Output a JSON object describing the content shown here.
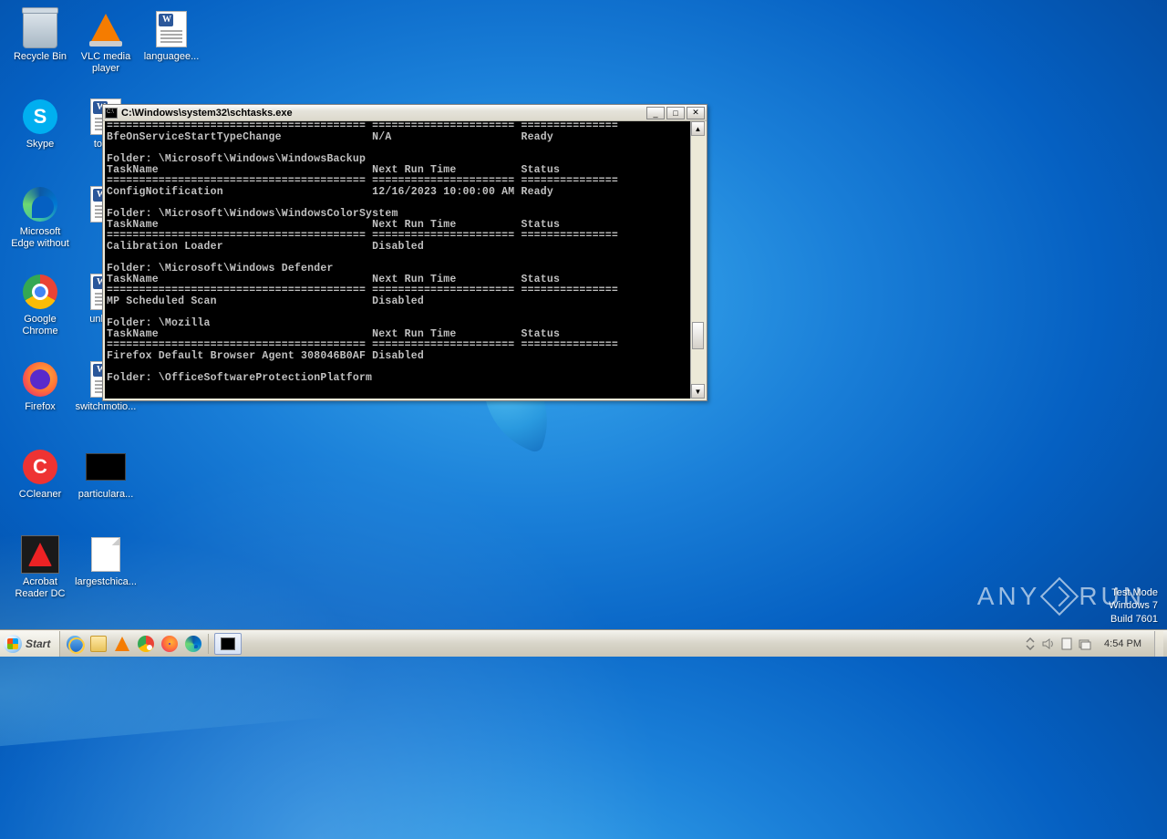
{
  "desktop": {
    "icons_col1": [
      {
        "label": "Recycle Bin",
        "art": "bin"
      },
      {
        "label": "Skype",
        "art": "skype"
      },
      {
        "label": "Microsoft Edge without",
        "art": "edge"
      },
      {
        "label": "Google Chrome",
        "art": "chrome"
      },
      {
        "label": "Firefox",
        "art": "firefox"
      },
      {
        "label": "CCleaner",
        "art": "ccleaner"
      },
      {
        "label": "Acrobat Reader DC",
        "art": "acrobat"
      }
    ],
    "icons_col2": [
      {
        "label": "VLC media player",
        "art": "vlc"
      },
      {
        "label": "toysd",
        "art": "docx"
      },
      {
        "label": "",
        "art": "docx"
      },
      {
        "label": "unknov",
        "art": "docx"
      },
      {
        "label": "switchmotio...",
        "art": "docx"
      },
      {
        "label": "particulara...",
        "art": "blackfile"
      },
      {
        "label": "largestchica...",
        "art": "genericfile"
      }
    ],
    "icons_col3": [
      {
        "label": "languagee...",
        "art": "docx"
      }
    ]
  },
  "console": {
    "title": "C:\\Windows\\system32\\schtasks.exe",
    "sep": "======================================== ====================== ===============",
    "rows": [
      "BfeOnServiceStartTypeChange              N/A                    Ready",
      "",
      "Folder: \\Microsoft\\Windows\\WindowsBackup",
      "TaskName                                 Next Run Time          Status",
      "======================================== ====================== ===============",
      "ConfigNotification                       12/16/2023 10:00:00 AM Ready",
      "",
      "Folder: \\Microsoft\\Windows\\WindowsColorSystem",
      "TaskName                                 Next Run Time          Status",
      "======================================== ====================== ===============",
      "Calibration Loader                       Disabled",
      "",
      "Folder: \\Microsoft\\Windows Defender",
      "TaskName                                 Next Run Time          Status",
      "======================================== ====================== ===============",
      "MP Scheduled Scan                        Disabled",
      "",
      "Folder: \\Mozilla",
      "TaskName                                 Next Run Time          Status",
      "======================================== ====================== ===============",
      "Firefox Default Browser Agent 308046B0AF Disabled",
      "",
      "Folder: \\OfficeSoftwareProtectionPlatform"
    ]
  },
  "taskbar": {
    "start": "Start",
    "clock": "4:54 PM"
  },
  "watermark": {
    "brand_left": "ANY",
    "brand_right": "RUN",
    "line1": "Test Mode",
    "line2": "Windows 7",
    "line3": "Build 7601"
  }
}
